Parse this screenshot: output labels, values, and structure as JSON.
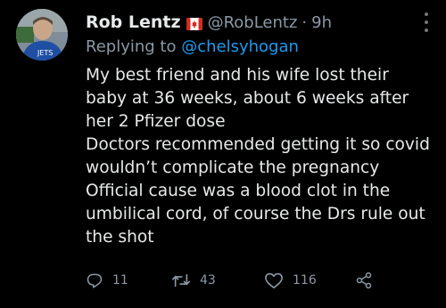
{
  "tweet": {
    "author_name": "Rob Lentz",
    "flag_icon": "canada-flag-icon",
    "handle": "@RobLentz",
    "separator": "·",
    "time": "9h",
    "reply_prefix": "Replying to ",
    "reply_to": "@chelsyhogan",
    "lines": [
      "My best friend and his wife lost their",
      "baby at 36 weeks, about 6 weeks after",
      "her 2 Pfizer dose",
      "Doctors recommended getting it so covid",
      "wouldn’t complicate the pregnancy",
      "Official cause was a blood clot in the",
      "umbilical cord, of course the Drs rule out",
      "the shot"
    ],
    "actions": {
      "reply_count": "11",
      "retweet_count": "43",
      "like_count": "116"
    }
  },
  "colors": {
    "background": "#000000",
    "text": "#e7e9ea",
    "secondary": "#8b98a5",
    "link": "#1d9bf0"
  }
}
